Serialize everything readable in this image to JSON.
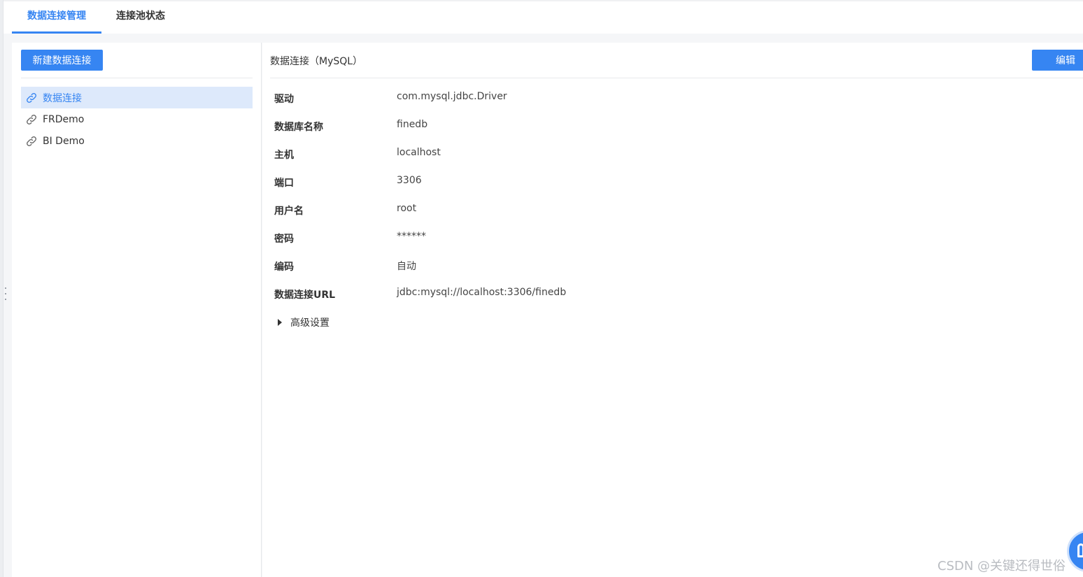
{
  "tabs": [
    {
      "label": "数据连接管理",
      "active": true
    },
    {
      "label": "连接池状态",
      "active": false
    }
  ],
  "left_panel": {
    "new_button_label": "新建数据连接",
    "connections": [
      {
        "name": "数据连接",
        "selected": true
      },
      {
        "name": "FRDemo",
        "selected": false
      },
      {
        "name": "BI Demo",
        "selected": false
      }
    ]
  },
  "detail": {
    "title": "数据连接（MySQL）",
    "edit_button_label": "编辑",
    "fields": [
      {
        "label": "驱动",
        "value": "com.mysql.jdbc.Driver"
      },
      {
        "label": "数据库名称",
        "value": "finedb"
      },
      {
        "label": "主机",
        "value": "localhost"
      },
      {
        "label": "端口",
        "value": "3306"
      },
      {
        "label": "用户名",
        "value": "root"
      },
      {
        "label": "密码",
        "value": "******"
      },
      {
        "label": "编码",
        "value": "自动"
      },
      {
        "label": "数据连接URL",
        "value": "jdbc:mysql://localhost:3306/finedb"
      }
    ],
    "advanced_label": "高级设置"
  },
  "watermark": "CSDN @关键还得世俗",
  "icons": {
    "connection_item": "link-icon",
    "advanced_toggle": "caret-right-icon",
    "help": "help-fab-icon"
  },
  "colors": {
    "accent": "#3685f2",
    "selected_bg": "#dde9fb"
  }
}
